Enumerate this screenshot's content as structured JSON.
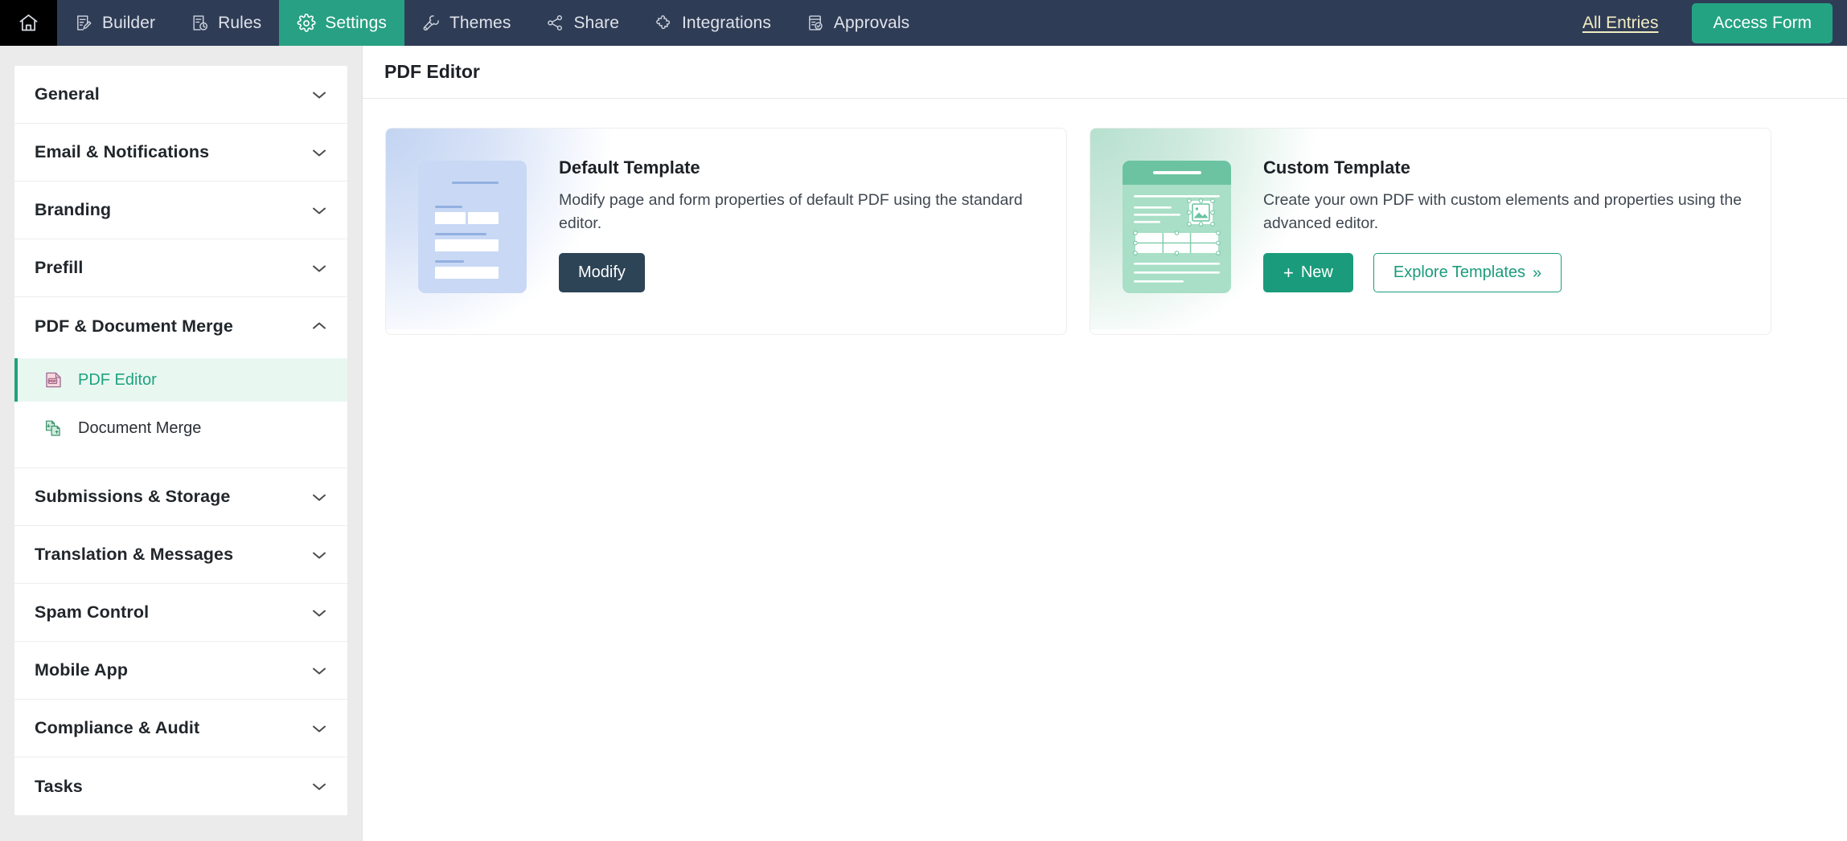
{
  "topnav": {
    "home_icon": "home-icon",
    "tabs": [
      {
        "label": "Builder",
        "icon": "builder-icon",
        "active": false
      },
      {
        "label": "Rules",
        "icon": "rules-icon",
        "active": false
      },
      {
        "label": "Settings",
        "icon": "gear-icon",
        "active": true
      },
      {
        "label": "Themes",
        "icon": "paintbrush-icon",
        "active": false
      },
      {
        "label": "Share",
        "icon": "share-nodes-icon",
        "active": false
      },
      {
        "label": "Integrations",
        "icon": "puzzle-piece-icon",
        "active": false
      },
      {
        "label": "Approvals",
        "icon": "document-check-icon",
        "active": false
      }
    ],
    "all_entries_label": "All Entries",
    "access_form_label": "Access Form",
    "bar_color": "#2f3c56",
    "active_tab_color": "#27a083",
    "all_entries_color": "#f3ecc3",
    "access_form_color": "#24a383"
  },
  "sidebar": {
    "sections": [
      {
        "label": "General",
        "expanded": false,
        "chevron": "chevron-down-icon"
      },
      {
        "label": "Email & Notifications",
        "expanded": false,
        "chevron": "chevron-down-icon"
      },
      {
        "label": "Branding",
        "expanded": false,
        "chevron": "chevron-down-icon"
      },
      {
        "label": "Prefill",
        "expanded": false,
        "chevron": "chevron-down-icon"
      },
      {
        "label": "PDF & Document Merge",
        "expanded": true,
        "chevron": "chevron-up-icon"
      },
      {
        "label": "Submissions & Storage",
        "expanded": false,
        "chevron": "chevron-down-icon"
      },
      {
        "label": "Translation & Messages",
        "expanded": false,
        "chevron": "chevron-down-icon"
      },
      {
        "label": "Spam Control",
        "expanded": false,
        "chevron": "chevron-down-icon"
      },
      {
        "label": "Mobile App",
        "expanded": false,
        "chevron": "chevron-down-icon"
      },
      {
        "label": "Compliance & Audit",
        "expanded": false,
        "chevron": "chevron-down-icon"
      },
      {
        "label": "Tasks",
        "expanded": false,
        "chevron": "chevron-down-icon"
      }
    ],
    "subitems": [
      {
        "label": "PDF Editor",
        "icon": "pdf-file-icon",
        "active": true
      },
      {
        "label": "Document Merge",
        "icon": "document-merge-icon",
        "active": false
      }
    ],
    "active_color": "#1ea37f",
    "active_bg": "#e9f7f1"
  },
  "main": {
    "page_title": "PDF Editor",
    "cards": [
      {
        "title": "Default Template",
        "description": "Modify page and form properties of default PDF using the standard editor.",
        "accent": "#c9d8f4",
        "thumbnail": "default-template-thumbnail",
        "buttons": [
          {
            "label": "Modify",
            "style": "dark",
            "color": "#2d4356",
            "icon": ""
          }
        ]
      },
      {
        "title": "Custom Template",
        "description": "Create your own PDF with custom elements and properties using the advanced editor.",
        "accent": "#a8dfc6",
        "thumbnail": "custom-template-thumbnail",
        "buttons": [
          {
            "label": "New",
            "style": "green",
            "color": "#1a9c7c",
            "icon": "plus-icon"
          },
          {
            "label": "Explore Templates",
            "style": "outline",
            "color": "#1a9c7c",
            "icon": "double-chevron-right-icon"
          }
        ]
      }
    ]
  }
}
